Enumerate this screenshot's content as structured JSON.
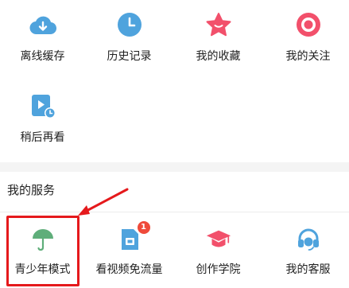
{
  "shortcuts_row1": [
    {
      "label": "离线缓存",
      "icon": "cloud-download-icon"
    },
    {
      "label": "历史记录",
      "icon": "clock-icon"
    },
    {
      "label": "我的收藏",
      "icon": "star-icon"
    },
    {
      "label": "我的关注",
      "icon": "follow-target-icon"
    }
  ],
  "shortcuts_row2": [
    {
      "label": "稍后再看",
      "icon": "watch-later-icon"
    }
  ],
  "services": {
    "title": "我的服务",
    "items": [
      {
        "label": "青少年模式",
        "icon": "umbrella-icon"
      },
      {
        "label": "看视频免流量",
        "icon": "sim-card-icon",
        "badge": "1"
      },
      {
        "label": "创作学院",
        "icon": "graduation-cap-icon"
      },
      {
        "label": "我的客服",
        "icon": "headset-icon"
      }
    ]
  },
  "colors": {
    "blue": "#4fa3dd",
    "pink": "#f2506b",
    "green": "#5fae7a",
    "highlight": "#e5191c"
  }
}
